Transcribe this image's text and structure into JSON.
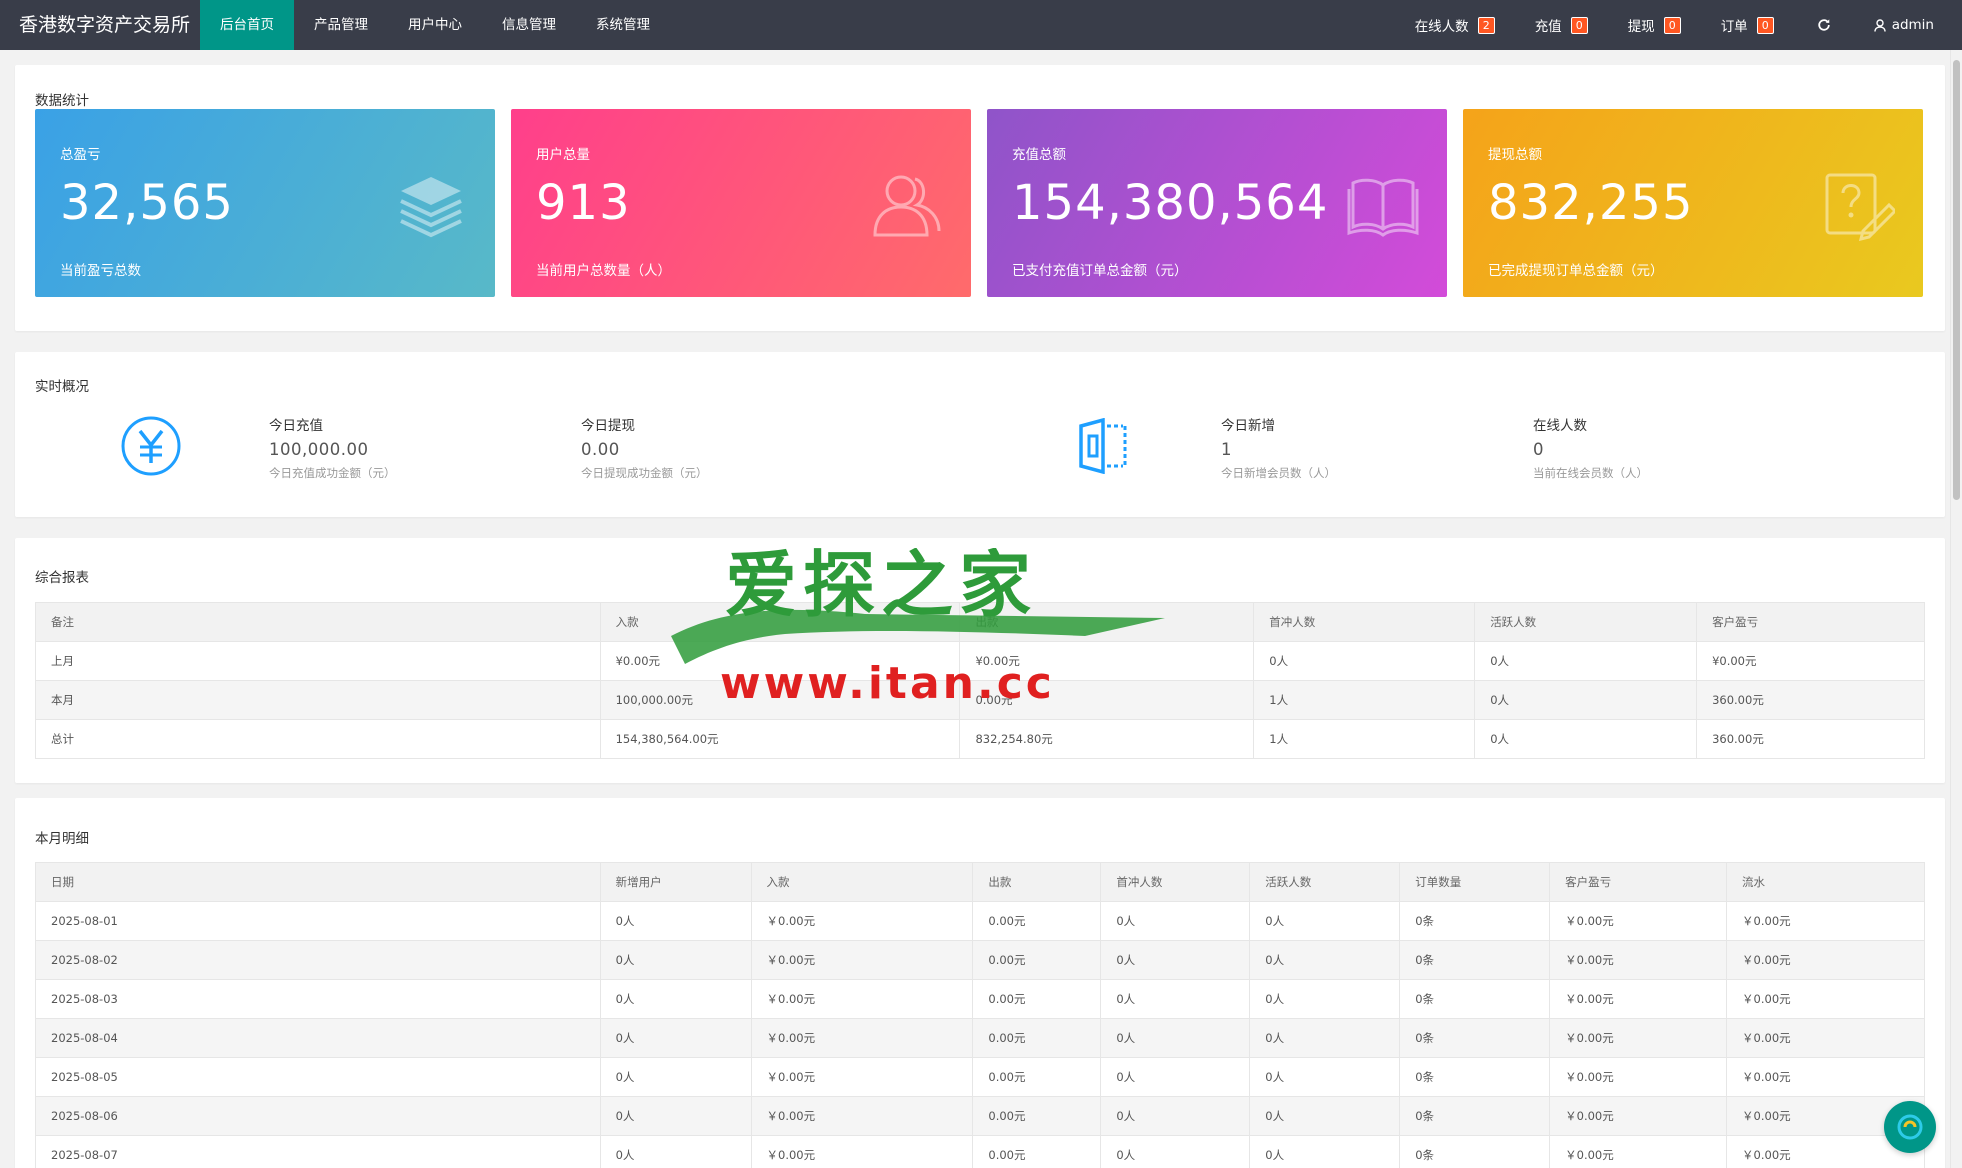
{
  "brand": "香港数字资产交易所",
  "nav": [
    "后台首页",
    "产品管理",
    "用户中心",
    "信息管理",
    "系统管理"
  ],
  "nav_right": {
    "online": {
      "label": "在线人数",
      "count": "2"
    },
    "recharge": {
      "label": "充值",
      "count": "0"
    },
    "withdraw": {
      "label": "提现",
      "count": "0"
    },
    "orders": {
      "label": "订单",
      "count": "0"
    },
    "refresh_icon": "refresh-icon",
    "user": "admin"
  },
  "stats": {
    "title": "数据统计",
    "cards": [
      {
        "label": "总盈亏",
        "value": "32,565",
        "desc": "当前盈亏总数",
        "icon": "layers-icon",
        "color": "#3aa1e6"
      },
      {
        "label": "用户总量",
        "value": "913",
        "desc": "当前用户总数量（人）",
        "icon": "users-icon",
        "color": "#ff3f8b"
      },
      {
        "label": "充值总额",
        "value": "154,380,564",
        "desc": "已支付充值订单总金额（元）",
        "icon": "book-icon",
        "color": "#8f54c9"
      },
      {
        "label": "提现总额",
        "value": "832,255",
        "desc": "已完成提现订单总金额（元）",
        "icon": "edit-question-icon",
        "color": "#f5a31a"
      }
    ]
  },
  "realtime": {
    "title": "实时概况",
    "items": [
      {
        "label": "今日充值",
        "value": "100,000.00",
        "desc": "今日充值成功金额（元）"
      },
      {
        "label": "今日提现",
        "value": "0.00",
        "desc": "今日提现成功金额（元）"
      },
      {
        "label": "今日新增",
        "value": "1",
        "desc": "今日新增会员数（人）"
      },
      {
        "label": "在线人数",
        "value": "0",
        "desc": "当前在线会员数（人）"
      }
    ]
  },
  "report": {
    "title": "综合报表",
    "headers": [
      "备注",
      "入款",
      "出款",
      "首冲人数",
      "活跃人数",
      "客户盈亏"
    ],
    "rows": [
      [
        "上月",
        "¥0.00元",
        "¥0.00元",
        "0人",
        "0人",
        "¥0.00元"
      ],
      [
        "本月",
        "100,000.00元",
        "0.00元",
        "1人",
        "0人",
        "360.00元"
      ],
      [
        "总计",
        "154,380,564.00元",
        "832,254.80元",
        "1人",
        "0人",
        "360.00元"
      ]
    ]
  },
  "monthly": {
    "title": "本月明细",
    "headers": [
      "日期",
      "新增用户",
      "入款",
      "出款",
      "首冲人数",
      "活跃人数",
      "订单数量",
      "客户盈亏",
      "流水"
    ],
    "rows": [
      [
        "2025-08-01",
        "0人",
        "￥0.00元",
        "0.00元",
        "0人",
        "0人",
        "0条",
        "￥0.00元",
        "￥0.00元"
      ],
      [
        "2025-08-02",
        "0人",
        "￥0.00元",
        "0.00元",
        "0人",
        "0人",
        "0条",
        "￥0.00元",
        "￥0.00元"
      ],
      [
        "2025-08-03",
        "0人",
        "￥0.00元",
        "0.00元",
        "0人",
        "0人",
        "0条",
        "￥0.00元",
        "￥0.00元"
      ],
      [
        "2025-08-04",
        "0人",
        "￥0.00元",
        "0.00元",
        "0人",
        "0人",
        "0条",
        "￥0.00元",
        "￥0.00元"
      ],
      [
        "2025-08-05",
        "0人",
        "￥0.00元",
        "0.00元",
        "0人",
        "0人",
        "0条",
        "￥0.00元",
        "￥0.00元"
      ],
      [
        "2025-08-06",
        "0人",
        "￥0.00元",
        "0.00元",
        "0人",
        "0人",
        "0条",
        "￥0.00元",
        "￥0.00元"
      ],
      [
        "2025-08-07",
        "0人",
        "￥0.00元",
        "0.00元",
        "0人",
        "0人",
        "0条",
        "￥0.00元",
        "￥0.00元"
      ]
    ]
  },
  "watermark": {
    "title": "爱探之家",
    "url": "www.itan.cc"
  },
  "colors": {
    "nav_bg": "#393d49",
    "active": "#009688",
    "badge": "#ff5722",
    "rt_icon": "#1e9fff"
  }
}
